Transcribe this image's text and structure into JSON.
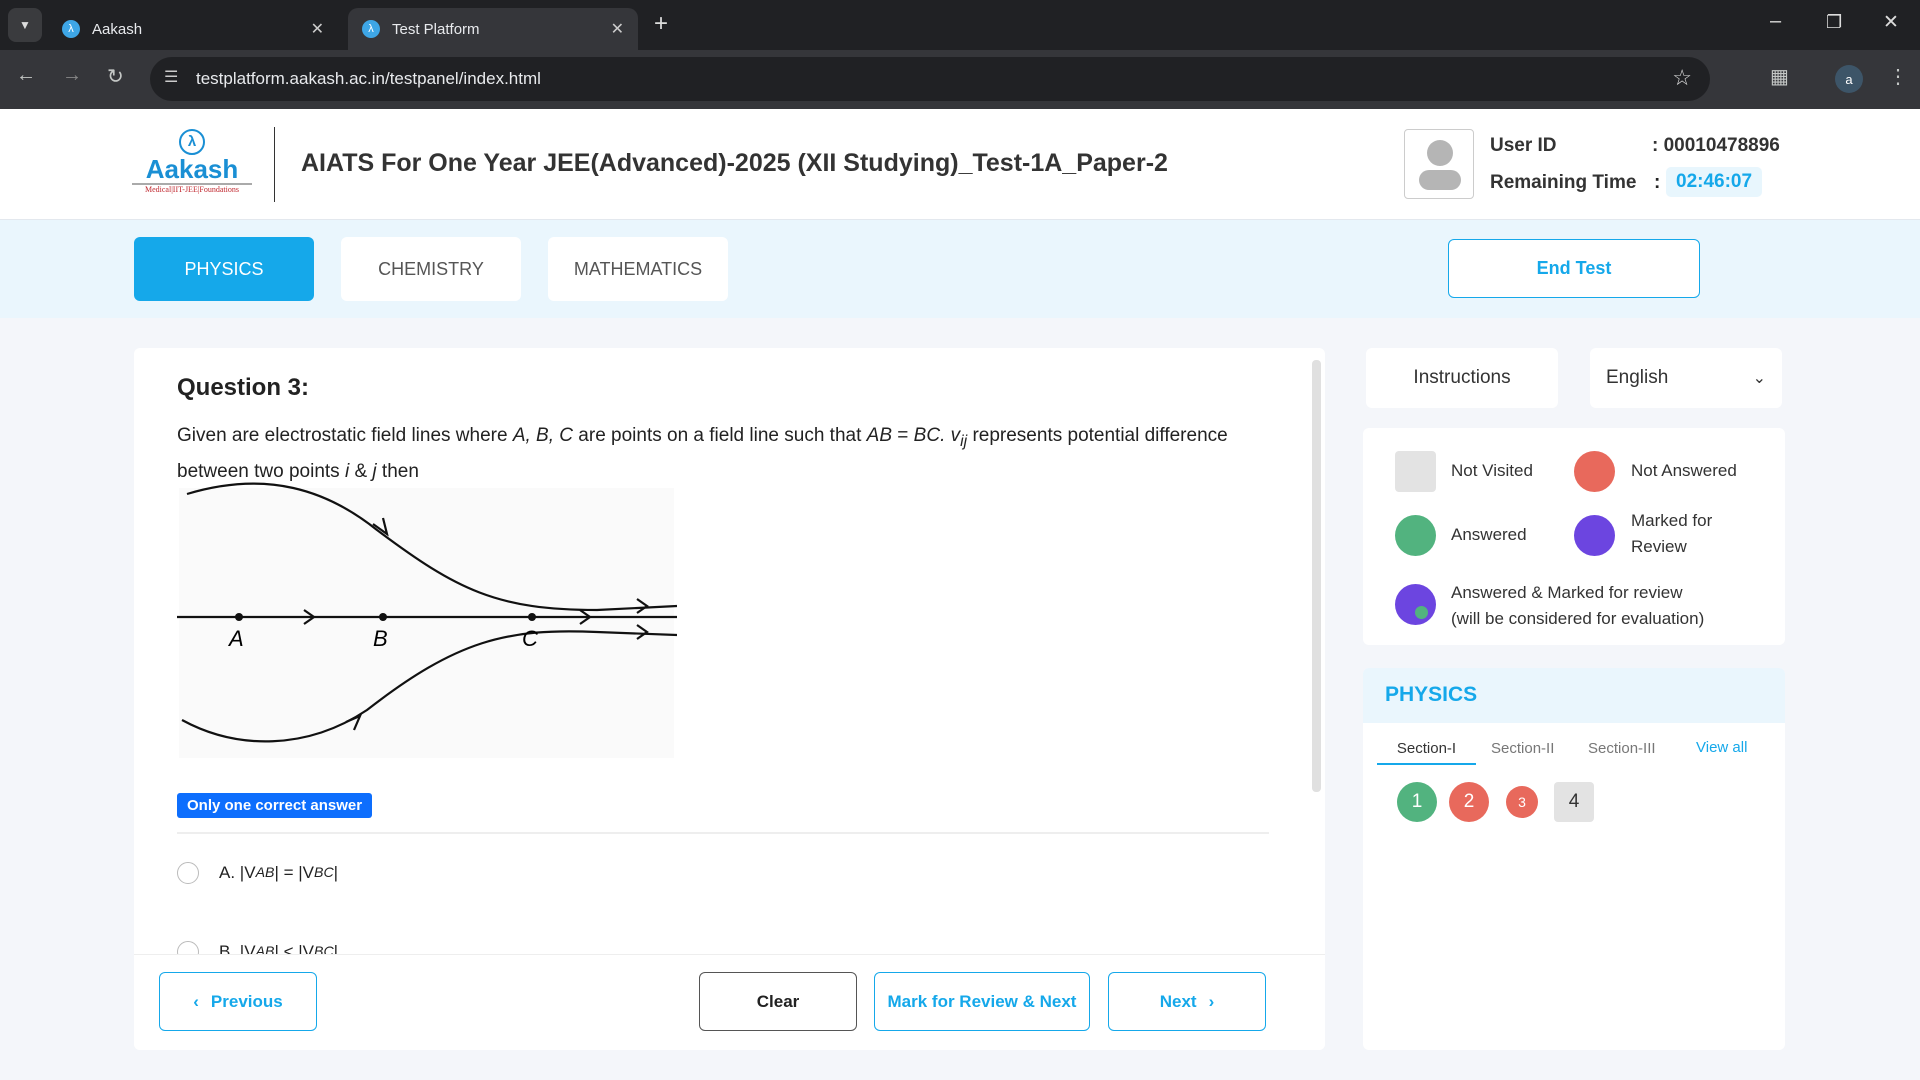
{
  "browser": {
    "tabs": [
      {
        "title": "Aakash"
      },
      {
        "title": "Test Platform",
        "active": true
      }
    ],
    "url": "testplatform.aakash.ac.in/testpanel/index.html",
    "profile_initial": "a"
  },
  "header": {
    "logo_text": "Aakash",
    "logo_tagline": "Medical|IIT-JEE|Foundations",
    "title": "AIATS For One Year JEE(Advanced)-2025 (XII Studying)_Test-1A_Paper-2",
    "user_id_label": "User ID",
    "user_id": ": 00010478896",
    "remaining_label": "Remaining Time",
    "remaining_colon": ":",
    "remaining_time": "02:46:07"
  },
  "subjects": [
    {
      "label": "PHYSICS",
      "active": true
    },
    {
      "label": "CHEMISTRY"
    },
    {
      "label": "MATHEMATICS"
    }
  ],
  "end_test": "End Test",
  "question": {
    "title": "Question 3:",
    "text_parts": [
      "Given are electrostatic field lines where ",
      "A, B, C",
      " are points on a field line such that ",
      "AB",
      " = ",
      "BC. v",
      "ij",
      " represents potential difference between two points ",
      "i",
      " & ",
      "j",
      " then"
    ],
    "figure_labels": [
      "A",
      "B",
      "C"
    ],
    "answer_type": "Only one correct answer",
    "options": [
      {
        "label": "A.",
        "text": "|V",
        "sub1": "AB",
        "mid": "| = |V",
        "sub2": "BC",
        "end": "|"
      },
      {
        "label": "B.",
        "text": "|V",
        "sub1": "AB",
        "mid": "| < |V",
        "sub2": "BC",
        "end": "|"
      }
    ]
  },
  "footer": {
    "previous": "Previous",
    "clear": "Clear",
    "mark_review": "Mark for Review & Next",
    "next": "Next"
  },
  "side": {
    "instructions": "Instructions",
    "language": "English",
    "legend": {
      "not_visited": "Not Visited",
      "not_answered": "Not Answered",
      "answered": "Answered",
      "marked": "Marked for Review",
      "answered_marked": "Answered & Marked for review",
      "answered_marked_note": "(will be considered for evaluation)"
    },
    "palette": {
      "subject": "PHYSICS",
      "sections": [
        "Section-I",
        "Section-II",
        "Section-III"
      ],
      "view_all": "View all",
      "questions": [
        {
          "n": "1",
          "status": "answered"
        },
        {
          "n": "2",
          "status": "not_answered"
        },
        {
          "n": "3",
          "status": "not_answered"
        },
        {
          "n": "4",
          "status": "not_visited"
        }
      ]
    }
  },
  "colors": {
    "accent": "#15a8ea",
    "answered": "#52b37f",
    "not_answered": "#e8695c",
    "not_visited": "#e3e3e3",
    "marked": "#6c45e0"
  }
}
